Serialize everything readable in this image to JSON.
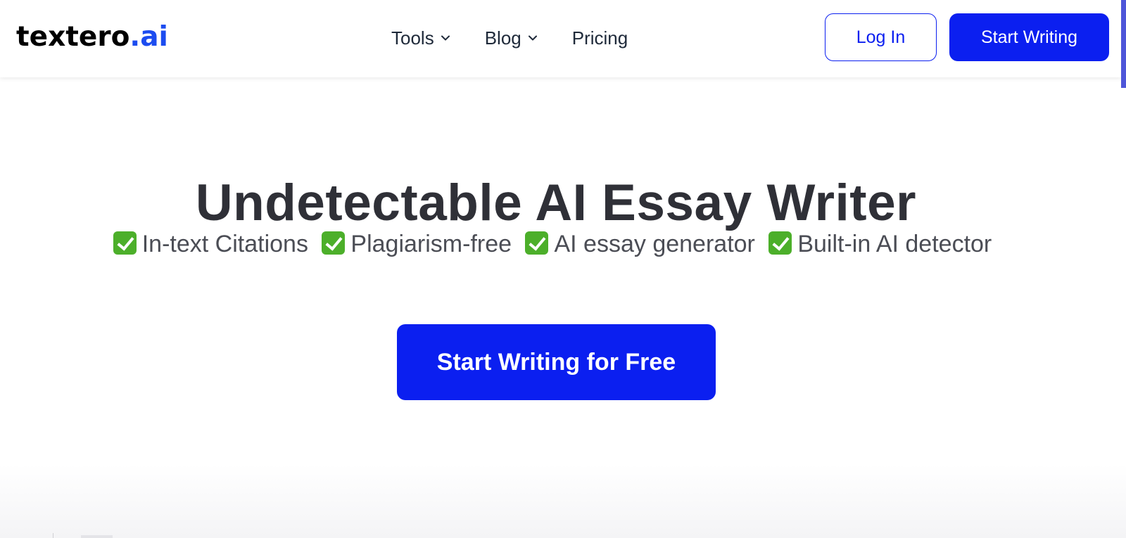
{
  "brand": {
    "name_main": "textero",
    "name_accent": ".ai",
    "accent_color": "#1c4cf0"
  },
  "nav": {
    "items": [
      {
        "label": "Tools",
        "has_dropdown": true,
        "icon": "chevron-down-icon"
      },
      {
        "label": "Blog",
        "has_dropdown": true,
        "icon": "chevron-down-icon"
      },
      {
        "label": "Pricing",
        "has_dropdown": false
      }
    ]
  },
  "header_actions": {
    "login_label": "Log In",
    "start_label": "Start Writing",
    "primary_color": "#0b1ff0"
  },
  "hero": {
    "title": "Undetectable AI Essay Writer",
    "features": [
      {
        "icon": "check-mark-icon",
        "label": "In-text Citations"
      },
      {
        "icon": "check-mark-icon",
        "label": "Plagiarism-free"
      },
      {
        "icon": "check-mark-icon",
        "label": "AI essay generator"
      },
      {
        "icon": "check-mark-icon",
        "label": "Built-in AI detector"
      }
    ],
    "cta_label": "Start Writing for Free"
  }
}
